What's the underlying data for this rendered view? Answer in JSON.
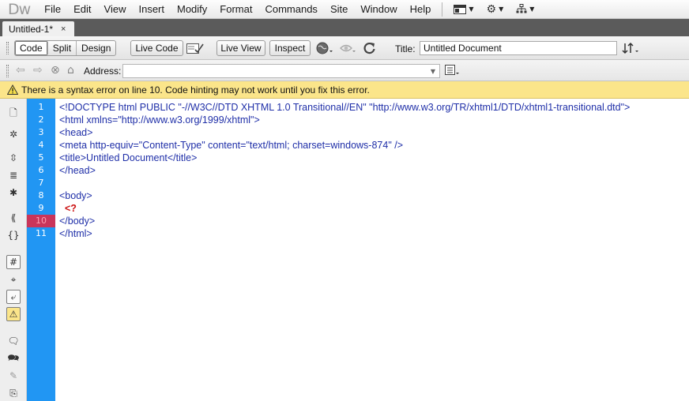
{
  "app": {
    "logo": "Dw",
    "menu": [
      "File",
      "Edit",
      "View",
      "Insert",
      "Modify",
      "Format",
      "Commands",
      "Site",
      "Window",
      "Help"
    ],
    "menu_tools": [
      "layout-icon",
      "gear-icon",
      "site-icon"
    ]
  },
  "tabs": [
    {
      "label": "Untitled-1*",
      "close": "×"
    }
  ],
  "toolbar": {
    "views": [
      "Code",
      "Split",
      "Design"
    ],
    "active_view": "Code",
    "live_code": "Live Code",
    "live_view": "Live View",
    "inspect": "Inspect",
    "title_label": "Title:",
    "title_value": "Untitled Document"
  },
  "address": {
    "label": "Address:",
    "value": ""
  },
  "warning": {
    "text": "There is a syntax error on line 10.  Code hinting may not work until you fix this error."
  },
  "editor": {
    "lines": [
      {
        "num": "1",
        "text": "<!DOCTYPE html PUBLIC \"-//W3C//DTD XHTML 1.0 Transitional//EN\" \"http://www.w3.org/TR/xhtml1/DTD/xhtml1-transitional.dtd\">"
      },
      {
        "num": "2",
        "text": "<html xmlns=\"http://www.w3.org/1999/xhtml\">"
      },
      {
        "num": "3",
        "text": "<head>"
      },
      {
        "num": "4",
        "text": "<meta http-equiv=\"Content-Type\" content=\"text/html; charset=windows-874\" />"
      },
      {
        "num": "5",
        "text": "<title>Untitled Document</title>"
      },
      {
        "num": "6",
        "text": "</head>"
      },
      {
        "num": "7",
        "text": ""
      },
      {
        "num": "8",
        "text": "<body>"
      },
      {
        "num": "9",
        "text": "  <?"
      },
      {
        "num": "10",
        "text": "</body>"
      },
      {
        "num": "11",
        "text": "</html>"
      }
    ],
    "error_line": "10",
    "colors": {
      "gutter": "#2196f3",
      "error_line": "#c9355a",
      "tag_text": "#1f2fa8",
      "php_text": "#cc1111",
      "warning_bg": "#fbe58a"
    }
  }
}
